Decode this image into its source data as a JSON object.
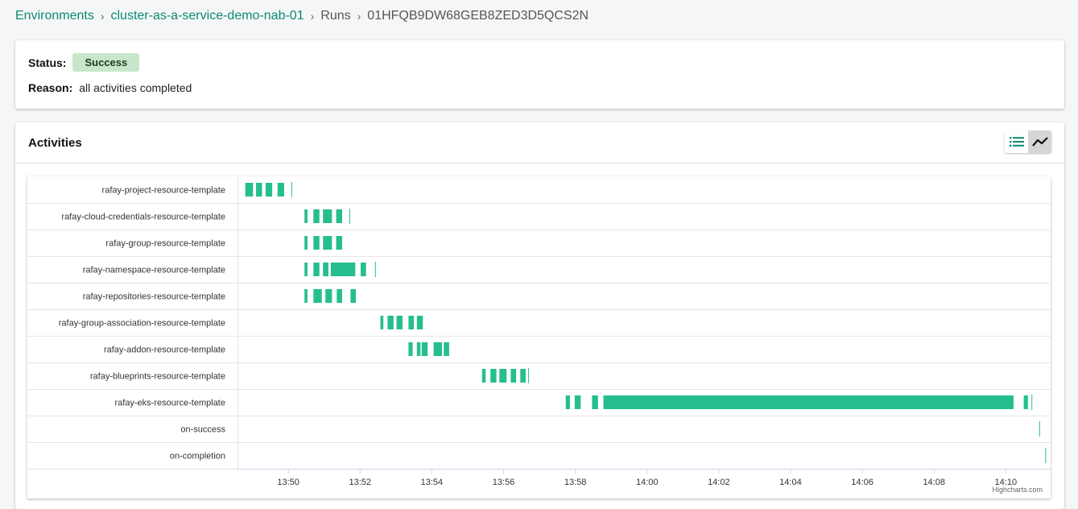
{
  "breadcrumb": {
    "environments": "Environments",
    "environment": "cluster-as-a-service-demo-nab-01",
    "runs": "Runs",
    "run_id": "01HFQB9DW68GEB8ZED3D5QCS2N",
    "separator": "›"
  },
  "status": {
    "status_label": "Status:",
    "status_value": "Success",
    "reason_label": "Reason:",
    "reason_value": "all activities completed",
    "badge_color": "#c8e6cb"
  },
  "activities": {
    "title": "Activities",
    "list_view_icon": "list-icon",
    "timeline_view_icon": "timeline-icon",
    "active_view": "timeline"
  },
  "chart_credit": "Highcharts.com",
  "chart_data": {
    "type": "gantt",
    "bar_color": "#26be8f",
    "grid": true,
    "x_axis": {
      "unit": "clock time",
      "min": "13:48:35",
      "max": "14:11:15",
      "ticks": [
        "13:50",
        "13:52",
        "13:54",
        "13:56",
        "13:58",
        "14:00",
        "14:02",
        "14:04",
        "14:06",
        "14:08",
        "14:10"
      ]
    },
    "categories": [
      "rafay-project-resource-template",
      "rafay-cloud-credentials-resource-template",
      "rafay-group-resource-template",
      "rafay-namespace-resource-template",
      "rafay-repositories-resource-template",
      "rafay-group-association-resource-template",
      "rafay-addon-resource-template",
      "rafay-blueprints-resource-template",
      "rafay-eks-resource-template",
      "on-success",
      "on-completion"
    ],
    "tasks": [
      {
        "row": 0,
        "start": "13:48:48",
        "end": "13:49:01"
      },
      {
        "row": 0,
        "start": "13:49:06",
        "end": "13:49:16"
      },
      {
        "row": 0,
        "start": "13:49:22",
        "end": "13:49:33"
      },
      {
        "row": 0,
        "start": "13:49:42",
        "end": "13:49:53"
      },
      {
        "row": 0,
        "start": "13:50:05",
        "end": "13:50:06"
      },
      {
        "row": 1,
        "start": "13:50:27",
        "end": "13:50:32"
      },
      {
        "row": 1,
        "start": "13:50:42",
        "end": "13:50:52"
      },
      {
        "row": 1,
        "start": "13:50:58",
        "end": "13:51:13"
      },
      {
        "row": 1,
        "start": "13:51:20",
        "end": "13:51:30"
      },
      {
        "row": 1,
        "start": "13:51:42",
        "end": "13:51:43"
      },
      {
        "row": 2,
        "start": "13:50:27",
        "end": "13:50:32"
      },
      {
        "row": 2,
        "start": "13:50:42",
        "end": "13:50:52"
      },
      {
        "row": 2,
        "start": "13:50:58",
        "end": "13:51:13"
      },
      {
        "row": 2,
        "start": "13:51:20",
        "end": "13:51:30"
      },
      {
        "row": 3,
        "start": "13:50:27",
        "end": "13:50:32"
      },
      {
        "row": 3,
        "start": "13:50:42",
        "end": "13:50:52"
      },
      {
        "row": 3,
        "start": "13:50:58",
        "end": "13:51:07"
      },
      {
        "row": 3,
        "start": "13:51:11",
        "end": "13:51:52"
      },
      {
        "row": 3,
        "start": "13:52:01",
        "end": "13:52:10"
      },
      {
        "row": 3,
        "start": "13:52:25",
        "end": "13:52:26"
      },
      {
        "row": 4,
        "start": "13:50:27",
        "end": "13:50:32"
      },
      {
        "row": 4,
        "start": "13:50:42",
        "end": "13:50:56"
      },
      {
        "row": 4,
        "start": "13:51:02",
        "end": "13:51:13"
      },
      {
        "row": 4,
        "start": "13:51:21",
        "end": "13:51:30"
      },
      {
        "row": 4,
        "start": "13:51:44",
        "end": "13:51:53"
      },
      {
        "row": 5,
        "start": "13:52:34",
        "end": "13:52:39"
      },
      {
        "row": 5,
        "start": "13:52:46",
        "end": "13:52:56"
      },
      {
        "row": 5,
        "start": "13:53:01",
        "end": "13:53:11"
      },
      {
        "row": 5,
        "start": "13:53:21",
        "end": "13:53:30"
      },
      {
        "row": 5,
        "start": "13:53:35",
        "end": "13:53:45"
      },
      {
        "row": 6,
        "start": "13:53:21",
        "end": "13:53:28"
      },
      {
        "row": 6,
        "start": "13:53:35",
        "end": "13:53:41"
      },
      {
        "row": 6,
        "start": "13:53:43",
        "end": "13:53:53"
      },
      {
        "row": 6,
        "start": "13:54:03",
        "end": "13:54:17"
      },
      {
        "row": 6,
        "start": "13:54:20",
        "end": "13:54:29"
      },
      {
        "row": 7,
        "start": "13:55:24",
        "end": "13:55:30"
      },
      {
        "row": 7,
        "start": "13:55:38",
        "end": "13:55:48"
      },
      {
        "row": 7,
        "start": "13:55:53",
        "end": "13:56:05"
      },
      {
        "row": 7,
        "start": "13:56:12",
        "end": "13:56:21"
      },
      {
        "row": 7,
        "start": "13:56:28",
        "end": "13:56:37"
      },
      {
        "row": 7,
        "start": "13:56:41",
        "end": "13:56:42"
      },
      {
        "row": 8,
        "start": "13:57:44",
        "end": "13:57:51"
      },
      {
        "row": 8,
        "start": "13:57:59",
        "end": "13:58:09"
      },
      {
        "row": 8,
        "start": "13:58:28",
        "end": "13:58:38"
      },
      {
        "row": 8,
        "start": "13:58:47",
        "end": "14:10:13"
      },
      {
        "row": 8,
        "start": "14:10:30",
        "end": "14:10:37"
      },
      {
        "row": 8,
        "start": "14:10:43",
        "end": "14:10:44"
      },
      {
        "row": 9,
        "start": "14:10:56",
        "end": "14:10:57"
      },
      {
        "row": 10,
        "start": "14:11:06",
        "end": "14:11:07"
      }
    ]
  }
}
